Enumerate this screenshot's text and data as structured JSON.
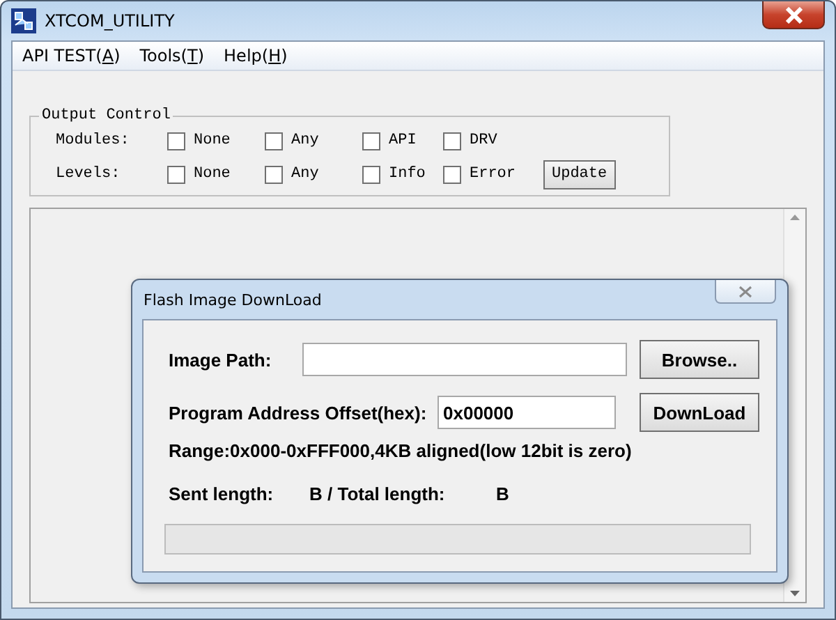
{
  "window": {
    "title": "XTCOM_UTILITY"
  },
  "menu": [
    {
      "label": "API TEST(",
      "key": "A",
      "suffix": ")"
    },
    {
      "label": "Tools(",
      "key": "T",
      "suffix": ")"
    },
    {
      "label": "Help(",
      "key": "H",
      "suffix": ")"
    }
  ],
  "output_control": {
    "title": "Output Control",
    "groups": [
      {
        "label": "Modules:",
        "options": [
          {
            "label": "None",
            "checked": false
          },
          {
            "label": "Any",
            "checked": false
          },
          {
            "label": "API",
            "checked": false
          },
          {
            "label": "DRV",
            "checked": false
          }
        ]
      },
      {
        "label": "Levels:",
        "options": [
          {
            "label": "None",
            "checked": false
          },
          {
            "label": "Any",
            "checked": false
          },
          {
            "label": "Info",
            "checked": false
          },
          {
            "label": "Error",
            "checked": false
          }
        ]
      }
    ],
    "button": "Update"
  },
  "dialog": {
    "title": "Flash Image DownLoad",
    "image_path": {
      "label": "Image Path:",
      "button": "Browse.."
    },
    "offset": {
      "label": "Program Address Offset(hex):",
      "value": "0x00000",
      "button": "DownLoad"
    },
    "range": "Range:0x000-0xFFF000,4KB aligned(low 12bit is zero)",
    "sent_label": "Sent length:",
    "total_label": "B / Total length:",
    "total_unit": "B",
    "progress": {
      "level": 0
    }
  }
}
